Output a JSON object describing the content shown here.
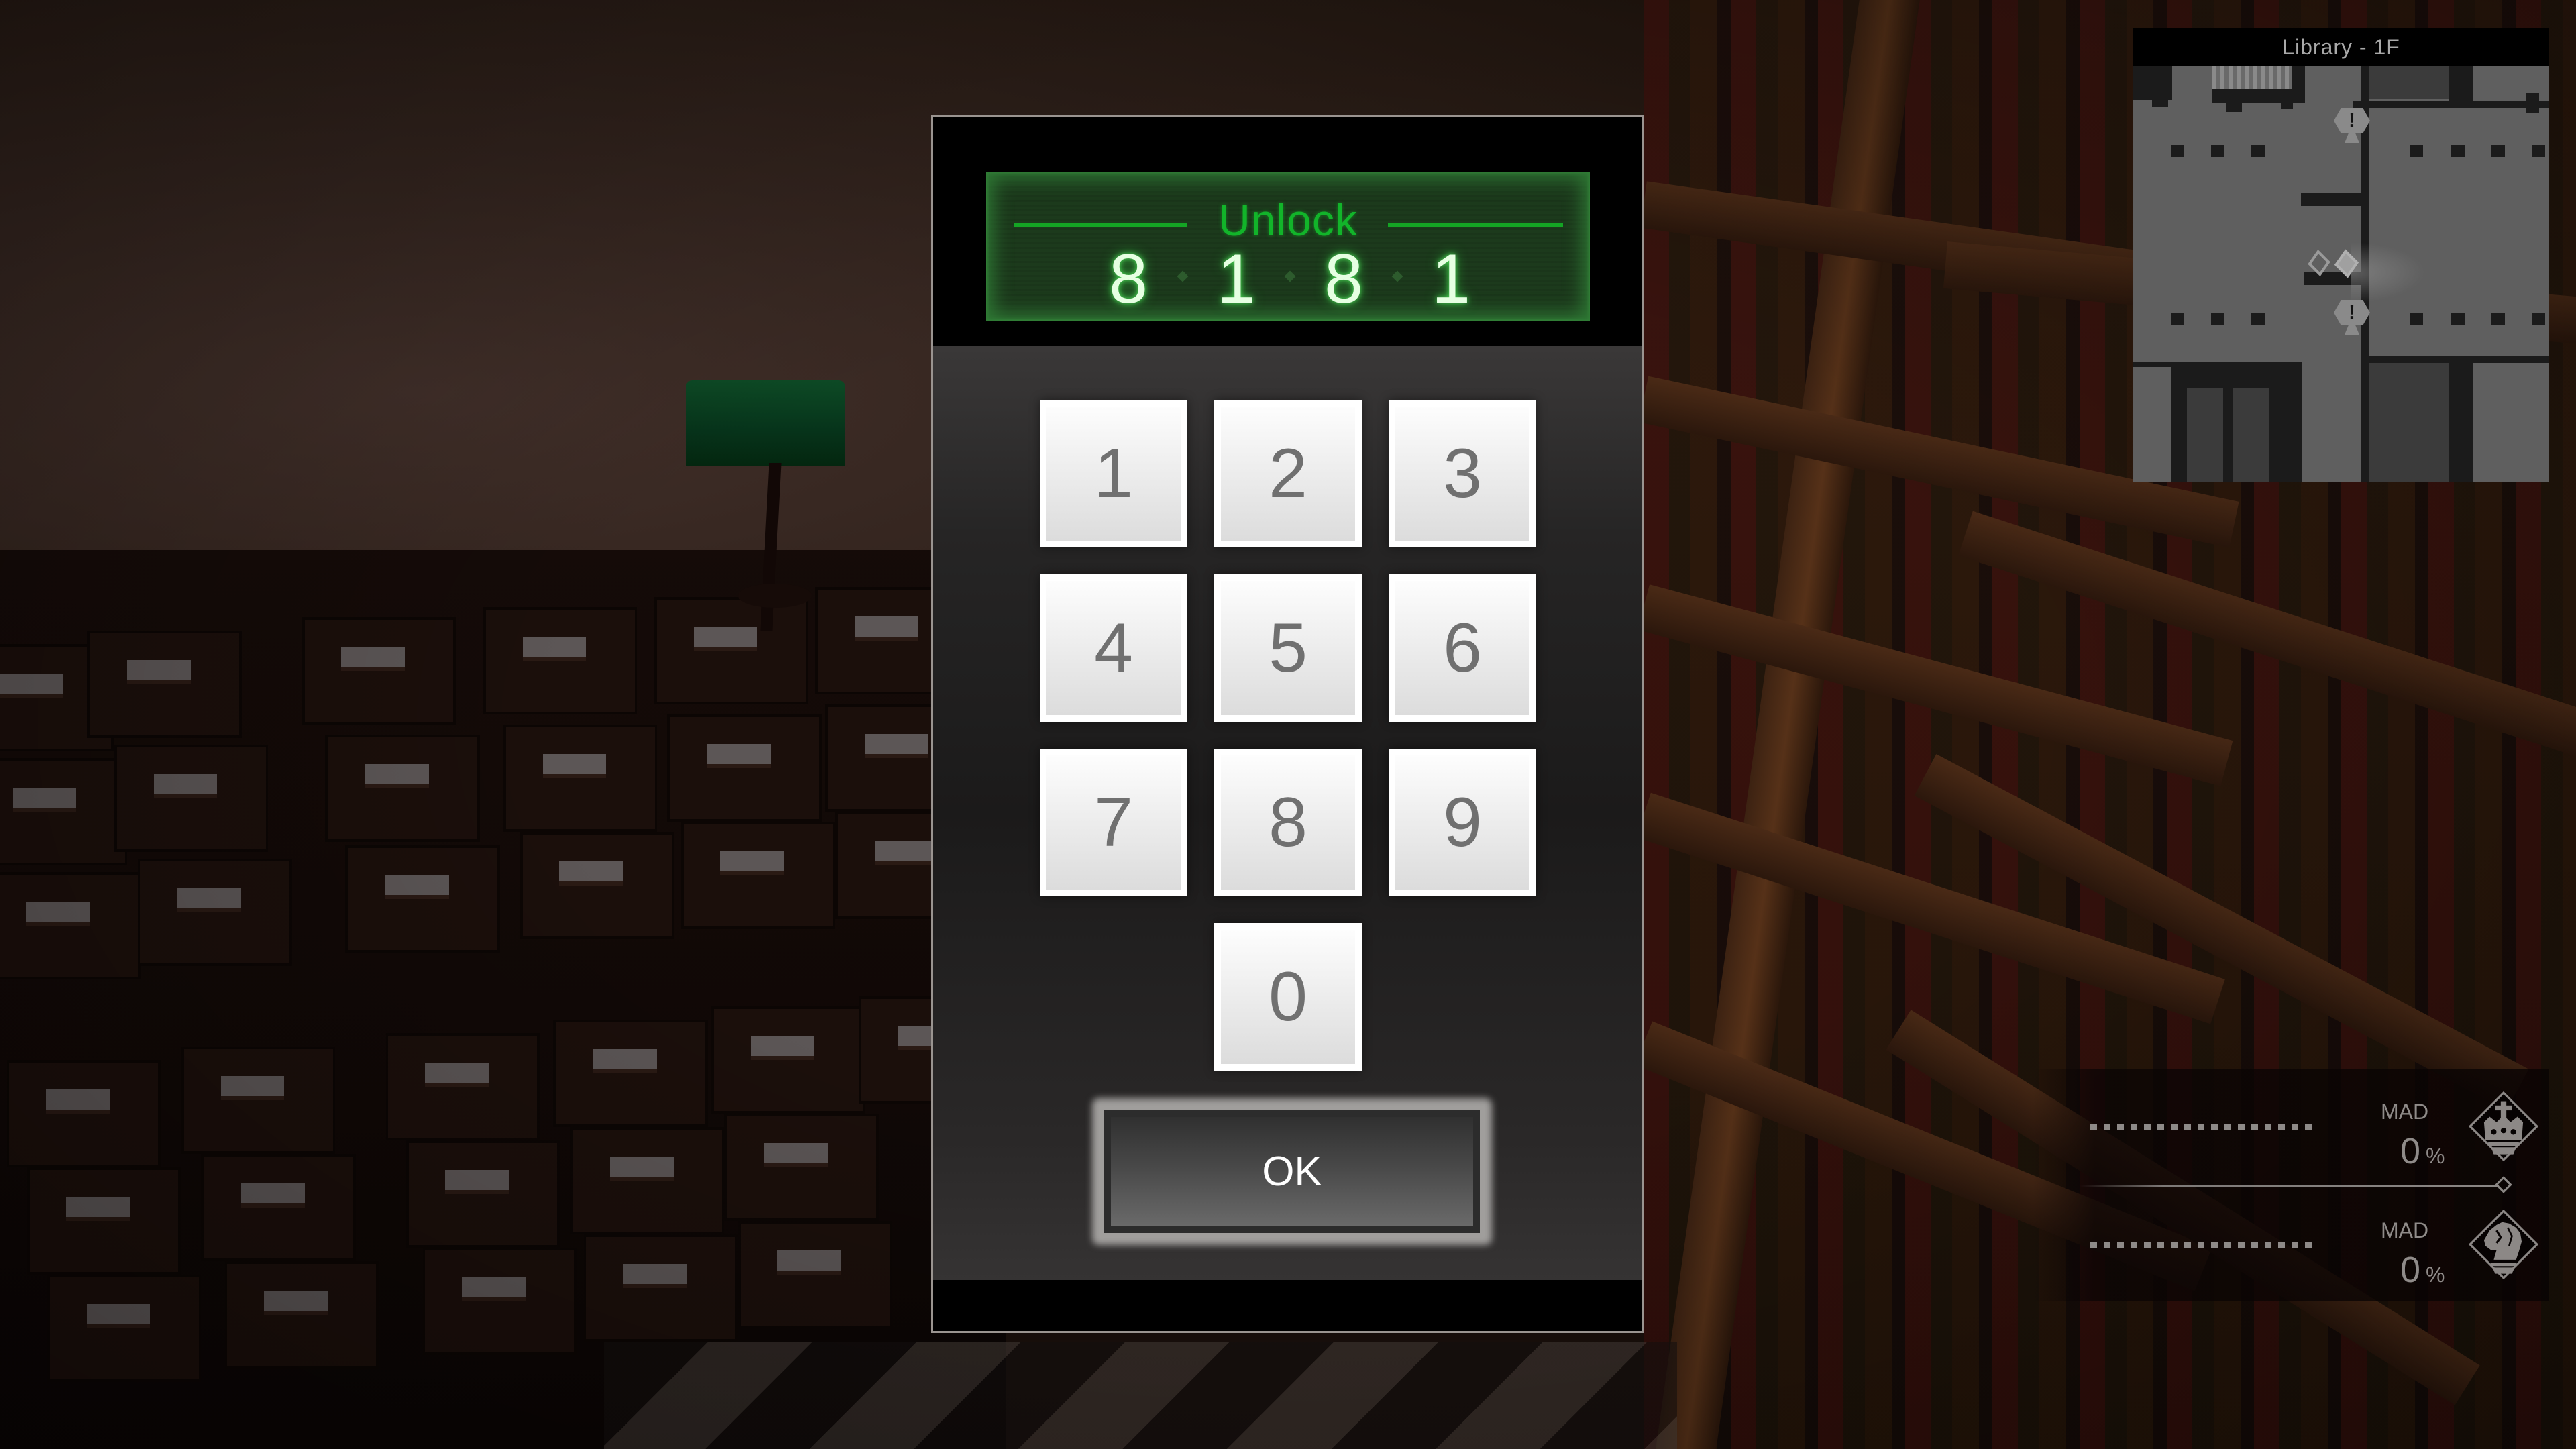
{
  "keypad": {
    "title": "Unlock",
    "entered_code": [
      "8",
      "1",
      "8",
      "1"
    ],
    "keys": [
      {
        "label": "1"
      },
      {
        "label": "2"
      },
      {
        "label": "3"
      },
      {
        "label": "4"
      },
      {
        "label": "5"
      },
      {
        "label": "6"
      },
      {
        "label": "7"
      },
      {
        "label": "8"
      },
      {
        "label": "9"
      },
      {
        "label": "0"
      }
    ],
    "ok_label": "OK",
    "colors": {
      "display_green": "#12b42a",
      "digit_glow": "#e6ffe2"
    }
  },
  "minimap": {
    "location": "Library - 1F",
    "markers": [
      {
        "icon": "alert-marker-icon",
        "symbol": "!"
      },
      {
        "icon": "alert-marker-icon",
        "symbol": "!"
      }
    ],
    "player_icon": "player-position-icon"
  },
  "status": {
    "characters": [
      {
        "icon": "king-piece-icon",
        "label": "MAD",
        "value": "0",
        "unit": "%"
      },
      {
        "icon": "knight-piece-icon",
        "label": "MAD",
        "value": "0",
        "unit": "%"
      }
    ]
  }
}
